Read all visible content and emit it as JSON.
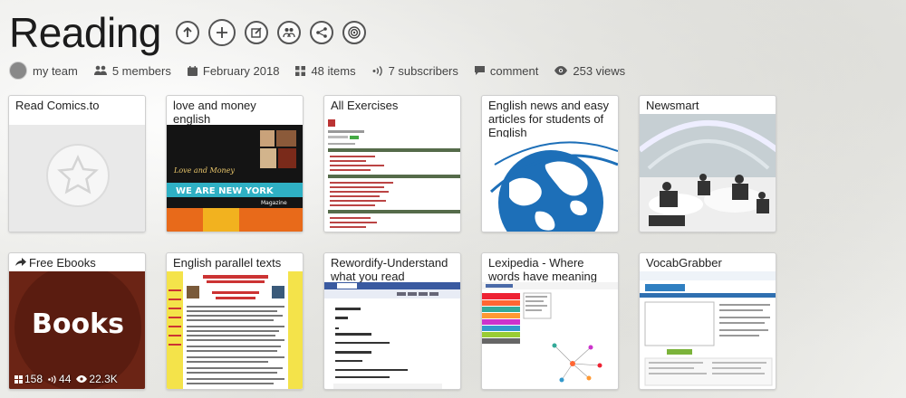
{
  "header": {
    "title": "Reading"
  },
  "meta": {
    "owner": "my team",
    "members": "5 members",
    "date": "February 2018",
    "items": "48 items",
    "subscribers": "7 subscribers",
    "comment": "comment",
    "views": "253 views"
  },
  "cards": [
    {
      "title": "Read Comics.to"
    },
    {
      "title": "love and money english"
    },
    {
      "title": "All Exercises"
    },
    {
      "title": "English news and easy articles for students of English"
    },
    {
      "title": "Newsmart"
    },
    {
      "title": "Free Ebooks",
      "thumb_text": "Books",
      "stats": {
        "items": "158",
        "subscribers": "44",
        "views": "22.3K"
      }
    },
    {
      "title": "English parallel texts"
    },
    {
      "title": "Rewordify-Understand what you read"
    },
    {
      "title": "Lexipedia - Where words have meaning"
    },
    {
      "title": "VocabGrabber"
    }
  ],
  "thumb_labels": {
    "love_money_banner": "Love and Money",
    "love_money_headline": "WE ARE NEW YORK",
    "love_money_sub": "Magazine"
  }
}
